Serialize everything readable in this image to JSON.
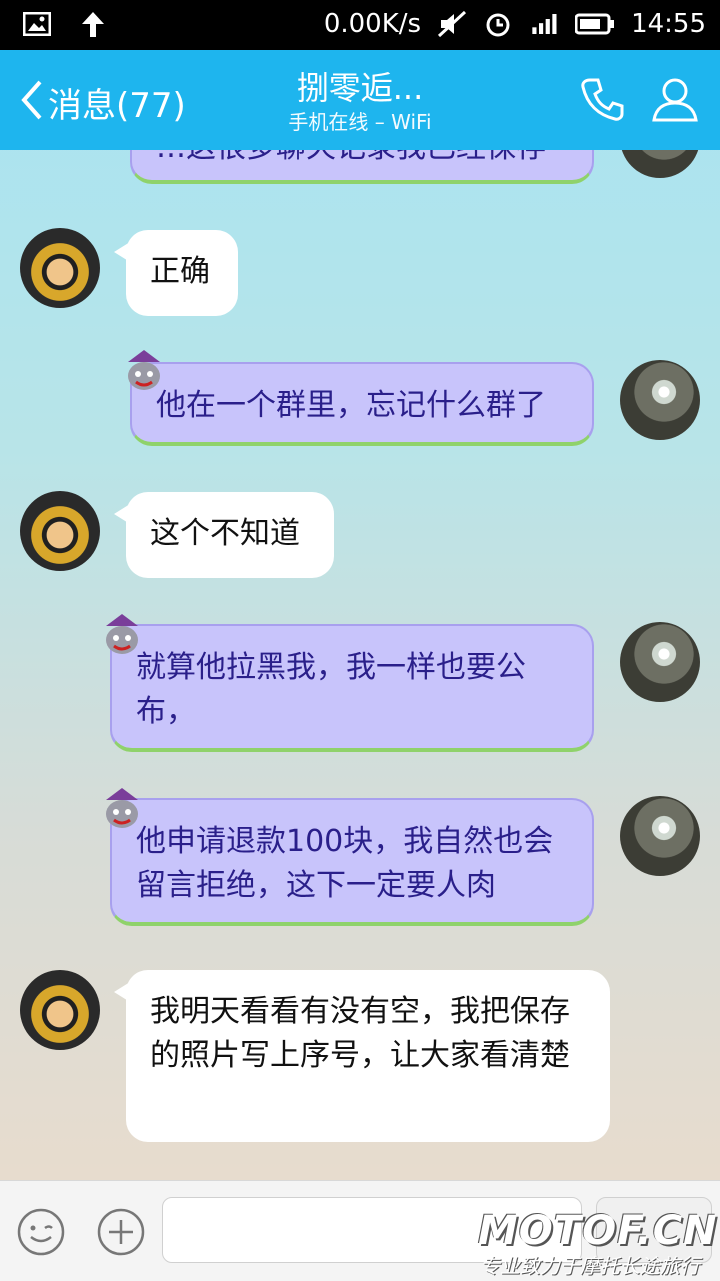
{
  "status_bar": {
    "net_speed": "0.00K/s",
    "time": "14:55",
    "icons": [
      "image-icon",
      "upload-arrow-icon",
      "mute-icon",
      "alarm-icon",
      "signal-icon",
      "battery-icon"
    ]
  },
  "header": {
    "back_label": "消息(77)",
    "title": "捌零逅...",
    "subtitle": "手机在线 – WiFi",
    "icons": [
      "phone-icon",
      "contact-icon"
    ]
  },
  "messages": [
    {
      "side": "right",
      "text": "…这很多聊天记录我已经保存"
    },
    {
      "side": "left",
      "text": "正确"
    },
    {
      "side": "right",
      "text": "他在一个群里，忘记什么群了"
    },
    {
      "side": "left",
      "text": "这个不知道"
    },
    {
      "side": "right",
      "text": "就算他拉黑我，我一样也要公布，"
    },
    {
      "side": "right",
      "text": "他申请退款100块，我自然也会留言拒绝，这下一定要人肉"
    },
    {
      "side": "left",
      "text": "我明天看看有没有空，我把保存的照片写上序号，让大家看清楚"
    }
  ],
  "bottom_bar": {
    "icons": [
      "emoji-icon",
      "plus-icon"
    ],
    "input_placeholder": ""
  },
  "watermark": {
    "brand": "MOTOF.CN",
    "slogan": "专业致力于摩托长途旅行"
  },
  "colors": {
    "header": "#1eb5ee",
    "my_bubble": "#c8c4fb",
    "my_text": "#2a1f8a"
  }
}
